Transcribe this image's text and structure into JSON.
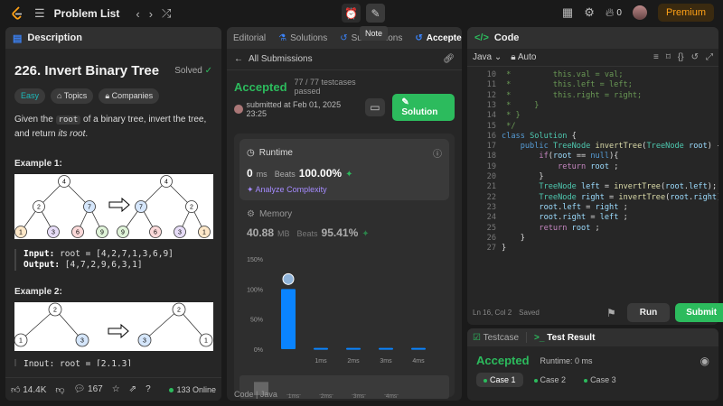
{
  "topbar": {
    "title": "Problem List",
    "streak": "0",
    "premium": "Premium",
    "note_tip": "Note"
  },
  "description": {
    "tab": "Description",
    "number_title": "226. Invert Binary Tree",
    "solved": "Solved",
    "tags": [
      "Easy",
      "Topics",
      "Companies"
    ],
    "p_pre": "Given the ",
    "p_code": "root",
    "p_mid": " of a binary tree, invert the tree, and return ",
    "p_em": "its root",
    "p_end": ".",
    "ex1_title": "Example 1:",
    "ex1_input_label": "Input:",
    "ex1_input": "root = [4,2,7,1,3,6,9]",
    "ex1_output_label": "Output:",
    "ex1_output": "[4,7,2,9,6,3,1]",
    "ex2_title": "Example 2:",
    "ex2_partial": "Input: root = [2,1,3]",
    "tree1_left": [
      "4",
      "2",
      "7",
      "1",
      "3",
      "6",
      "9"
    ],
    "tree1_right": [
      "4",
      "7",
      "2",
      "9",
      "6",
      "3",
      "1"
    ],
    "tree2_left": [
      "2",
      "1",
      "3"
    ],
    "tree2_right": [
      "2",
      "3",
      "1"
    ],
    "likes": "14.4K",
    "comments": "167",
    "online": "133 Online"
  },
  "middle": {
    "tabs": [
      "Editorial",
      "Solutions",
      "Submissions",
      "Accepted"
    ],
    "all_submissions": "All Submissions",
    "status": "Accepted",
    "testcases": "77 / 77 testcases passed",
    "submitted": "submitted at Feb 01, 2025 23:25",
    "solution_btn": "Solution",
    "runtime_label": "Runtime",
    "runtime_value": "0",
    "runtime_unit": "ms",
    "beats_label": "Beats",
    "runtime_beats": "100.00%",
    "analyze": "Analyze Complexity",
    "memory_label": "Memory",
    "memory_value": "40.88",
    "memory_unit": "MB",
    "memory_beats": "95.41%",
    "code_label": "Code",
    "code_lang": "Java"
  },
  "chart_data": {
    "type": "bar",
    "categories": [
      "0ms",
      "1ms",
      "2ms",
      "3ms",
      "4ms"
    ],
    "values": [
      100,
      2,
      2,
      2,
      2
    ],
    "y_ticks": [
      "150%",
      "100%",
      "50%",
      "0%"
    ],
    "ylim": [
      0,
      150
    ],
    "tick_labels": [
      "",
      "1ms",
      "2ms",
      "3ms",
      "4ms"
    ],
    "mini_tick_labels": [
      "1ms",
      "2ms",
      "3ms",
      "4ms"
    ],
    "bar_color": "#0a84ff"
  },
  "code": {
    "tab": "Code",
    "lang": "Java",
    "mode": "Auto",
    "cursor": "Ln 16, Col 2",
    "saved": "Saved",
    "run": "Run",
    "submit": "Submit",
    "lines": [
      {
        "n": "10",
        "t": " *         this.val = val;",
        "c": "cmt"
      },
      {
        "n": "11",
        "t": " *         this.left = left;",
        "c": "cmt"
      },
      {
        "n": "12",
        "t": " *         this.right = right;",
        "c": "cmt"
      },
      {
        "n": "13",
        "t": " *     }",
        "c": "cmt"
      },
      {
        "n": "14",
        "t": " * }",
        "c": "cmt"
      },
      {
        "n": "15",
        "t": " */",
        "c": "cmt"
      },
      {
        "n": "16",
        "t": "class Solution {",
        "c": ""
      },
      {
        "n": "17",
        "t": "    public TreeNode invertTree(TreeNode root) {",
        "c": ""
      },
      {
        "n": "18",
        "t": "        if(root == null){",
        "c": ""
      },
      {
        "n": "19",
        "t": "            return root ;",
        "c": ""
      },
      {
        "n": "20",
        "t": "        }",
        "c": ""
      },
      {
        "n": "21",
        "t": "        TreeNode left = invertTree(root.left);",
        "c": ""
      },
      {
        "n": "22",
        "t": "        TreeNode right = invertTree(root.right);",
        "c": ""
      },
      {
        "n": "23",
        "t": "        root.left = right ;",
        "c": ""
      },
      {
        "n": "24",
        "t": "        root.right = left ;",
        "c": ""
      },
      {
        "n": "25",
        "t": "        return root ;",
        "c": ""
      },
      {
        "n": "26",
        "t": "    }",
        "c": ""
      },
      {
        "n": "27",
        "t": "}",
        "c": ""
      }
    ]
  },
  "result": {
    "tab_testcase": "Testcase",
    "tab_result": "Test Result",
    "status": "Accepted",
    "runtime": "Runtime: 0 ms",
    "cases": [
      "Case 1",
      "Case 2",
      "Case 3"
    ]
  }
}
